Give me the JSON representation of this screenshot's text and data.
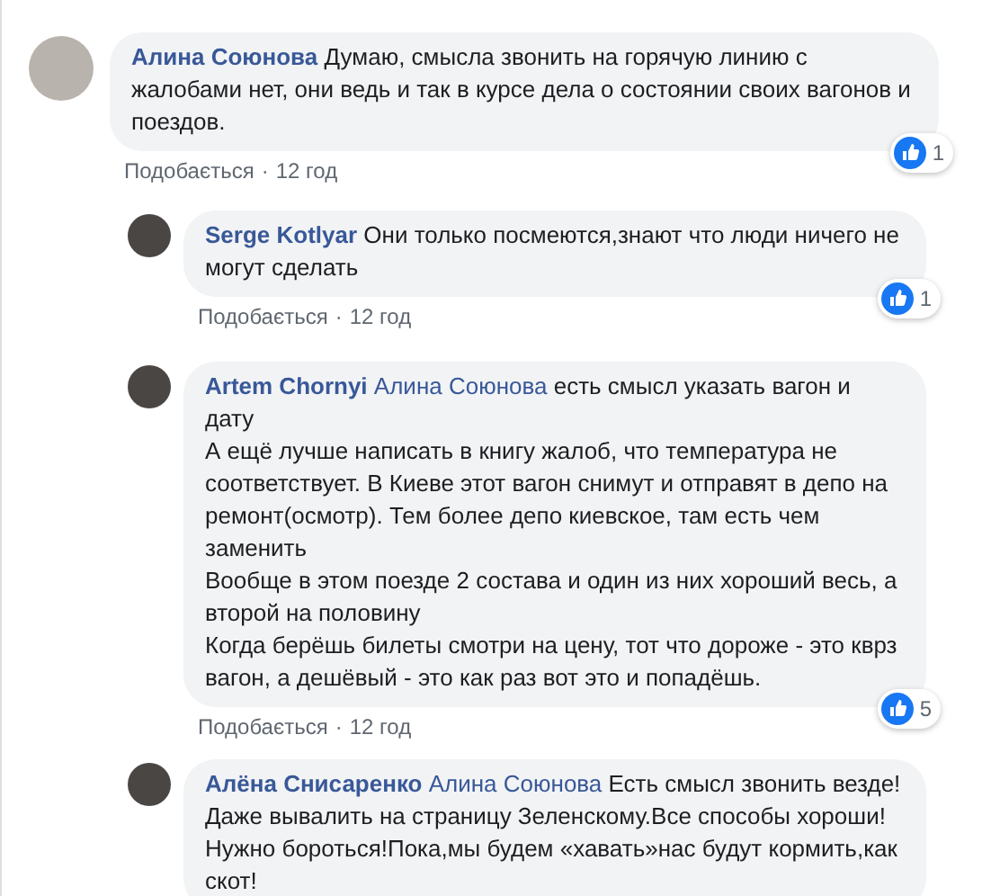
{
  "comments": [
    {
      "author": "Алина Союнова",
      "text": "Думаю, смысла звонить на горячую линию с жалобами нет, они ведь и так в курсе дела о состоянии своих вагонов и поездов.",
      "reply": false,
      "like": "Подобається",
      "separator": "·",
      "time": "12 год",
      "reactions": "1"
    },
    {
      "author": "Serge Kotlyar",
      "text": "Они только посмеются,знают что люди ничего не могут сделать",
      "reply": true,
      "like": "Подобається",
      "separator": "·",
      "time": "12 год",
      "reactions": "1"
    },
    {
      "author": "Artem Chornyi",
      "mention": "Алина Союнова",
      "text": "есть смысл указать вагон и дату\nА ещё лучше написать в книгу жалоб, что температура не соответствует. В Киеве этот вагон снимут и отправят в депо на ремонт(осмотр). Тем более депо киевское, там есть чем заменить\nВообще в этом поезде 2 состава и один из них хороший весь, а второй на половину\nКогда берёшь билеты смотри на цену, тот что дороже - это кврз вагон, а дешёвый - это как раз вот это и попадёшь.",
      "reply": true,
      "like": "Подобається",
      "separator": "·",
      "time": "12 год",
      "reactions": "5"
    },
    {
      "author": "Алёна Снисаренко",
      "mention": "Алина Союнова",
      "text": "Есть смысл звонить везде!Даже вывалить на страницу Зеленскому.Все способы хороши!Нужно бороться!Пока,мы будем «хавать»нас будут кормить,как скот!",
      "reply": true
    }
  ]
}
